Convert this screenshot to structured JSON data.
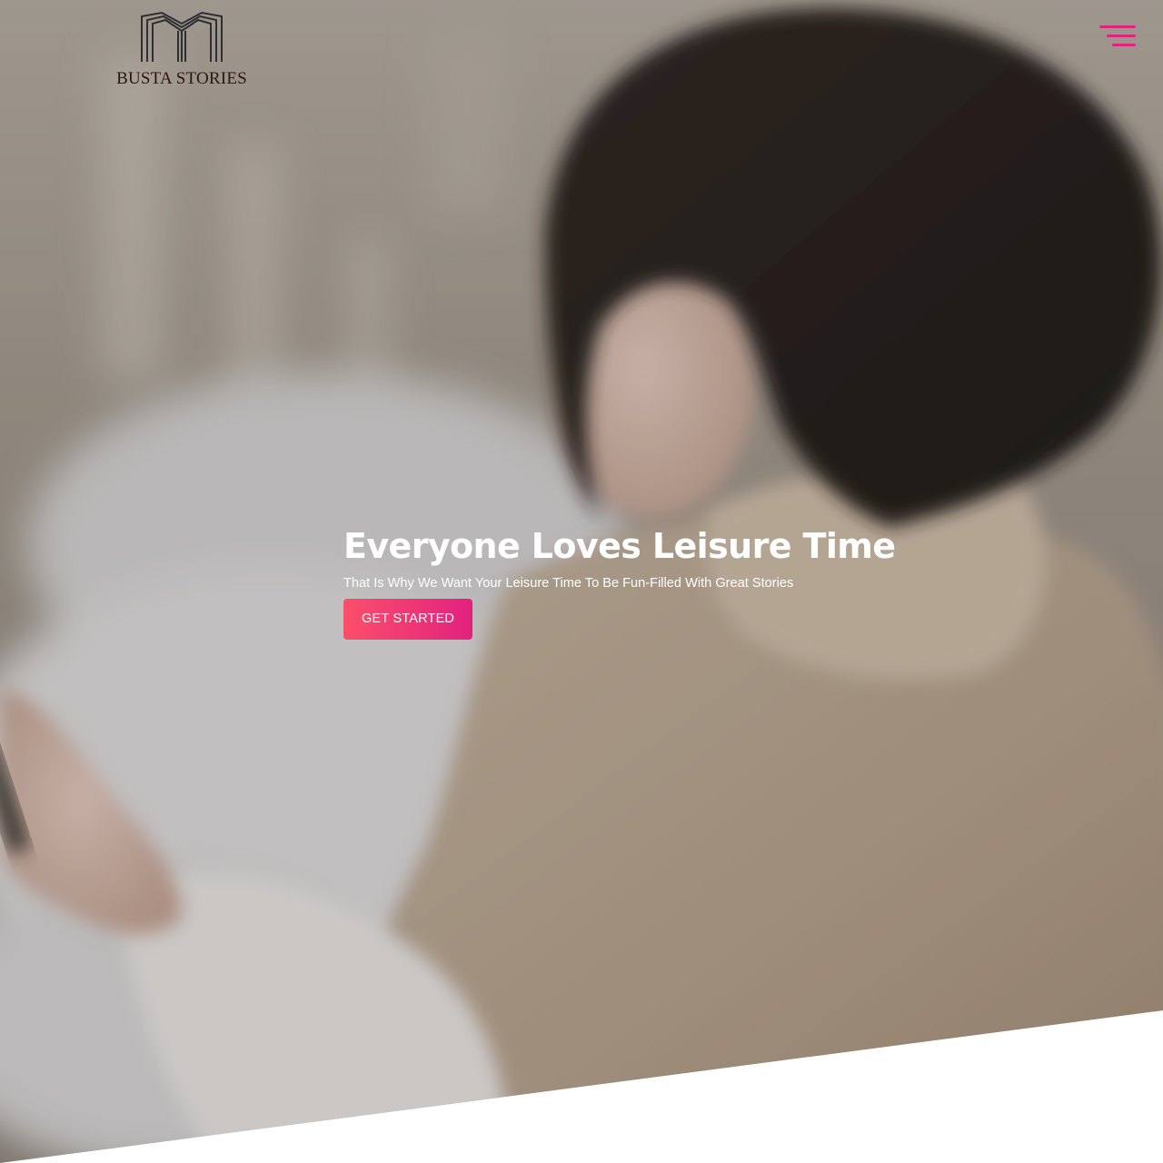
{
  "brand": {
    "name": "BUSTA STORIES",
    "logo_icon": "open-book-logo",
    "text_color": "#2b1612"
  },
  "nav": {
    "menu_icon": "hamburger-menu-icon",
    "accent_color": "#e0237e"
  },
  "hero": {
    "title": "Everyone Loves Leisure Time",
    "subtitle": "That Is Why We Want Your Leisure Time To Be Fun-Filled With Great Stories",
    "cta_label": "GET STARTED",
    "cta_gradient": [
      "#fb4f6a",
      "#e3217f"
    ],
    "background_image": "woman in knit sweater reading on phone"
  }
}
